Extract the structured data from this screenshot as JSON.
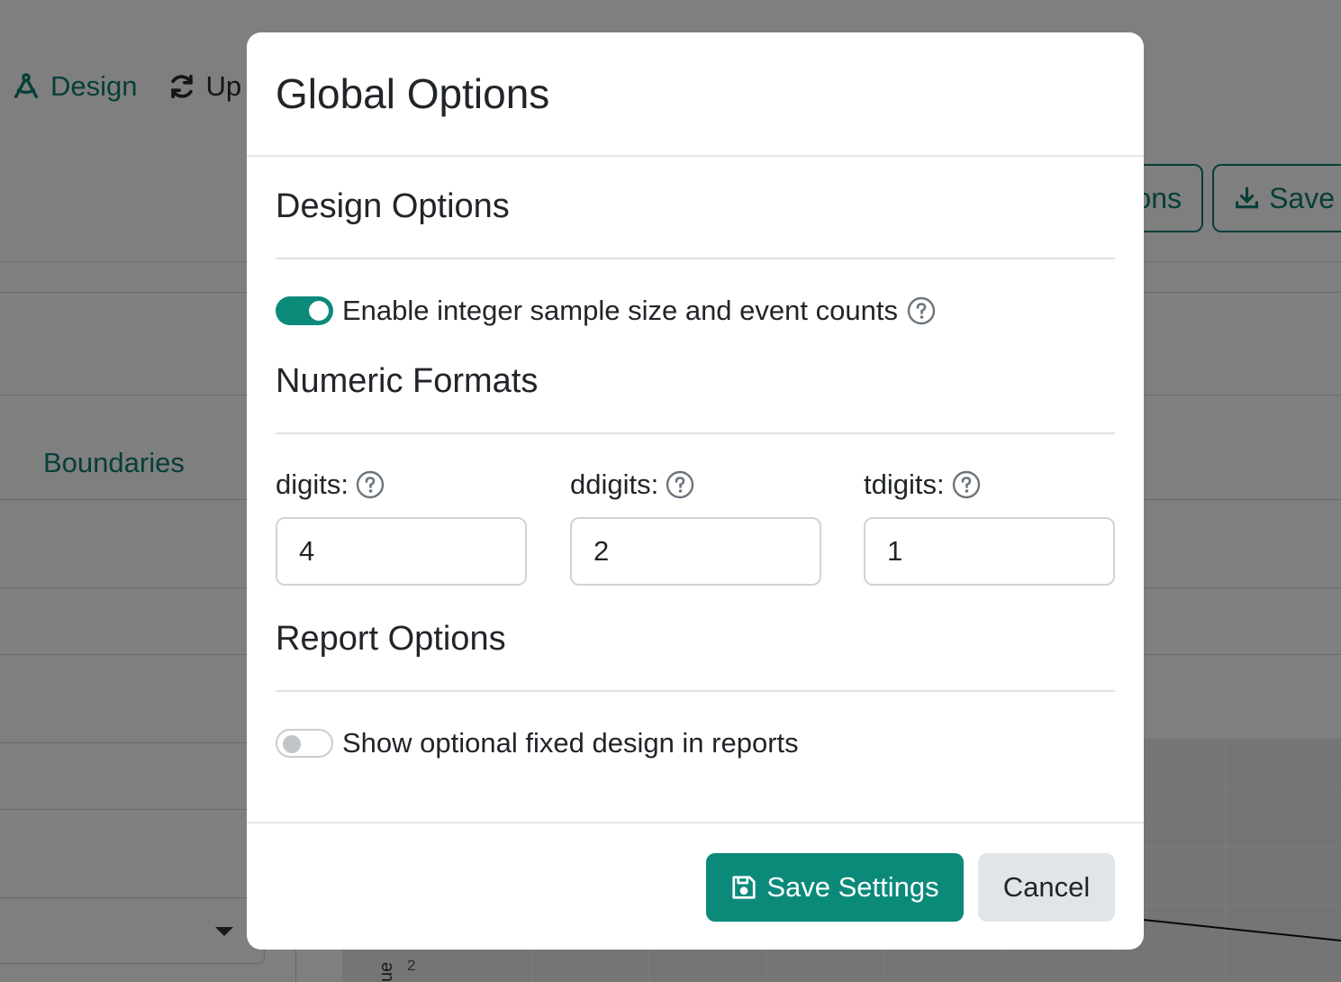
{
  "background": {
    "nav": [
      {
        "label": "Design",
        "icon": "compass-icon"
      },
      {
        "label": "Up",
        "icon": "refresh-icon"
      }
    ],
    "buttons": [
      {
        "label": "ons"
      },
      {
        "label": "Save",
        "icon": "download-icon"
      }
    ],
    "boundaries_label": "Boundaries",
    "plot": {
      "tick": "2",
      "axis_label": "ue"
    }
  },
  "modal": {
    "title": "Global Options",
    "design_options": {
      "title": "Design Options",
      "integer_toggle": {
        "label": "Enable integer sample size and event counts",
        "on": true
      }
    },
    "numeric_formats": {
      "title": "Numeric Formats",
      "fields": [
        {
          "label": "digits:",
          "value": "4"
        },
        {
          "label": "ddigits:",
          "value": "2"
        },
        {
          "label": "tdigits:",
          "value": "1"
        }
      ]
    },
    "report_options": {
      "title": "Report Options",
      "fixed_design_toggle": {
        "label": "Show optional fixed design in reports",
        "on": false
      }
    },
    "footer": {
      "save_label": "Save Settings",
      "cancel_label": "Cancel"
    }
  },
  "colors": {
    "accent": "#0b8a7a",
    "backdrop": "rgba(0,0,0,0.5)"
  }
}
